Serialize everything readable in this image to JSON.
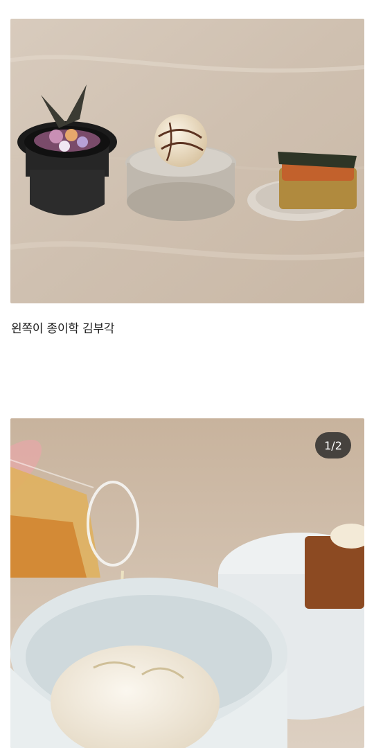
{
  "post": {
    "caption": "왼쪽이 종이학 김부각",
    "gallery": {
      "counter": "1/2"
    }
  }
}
